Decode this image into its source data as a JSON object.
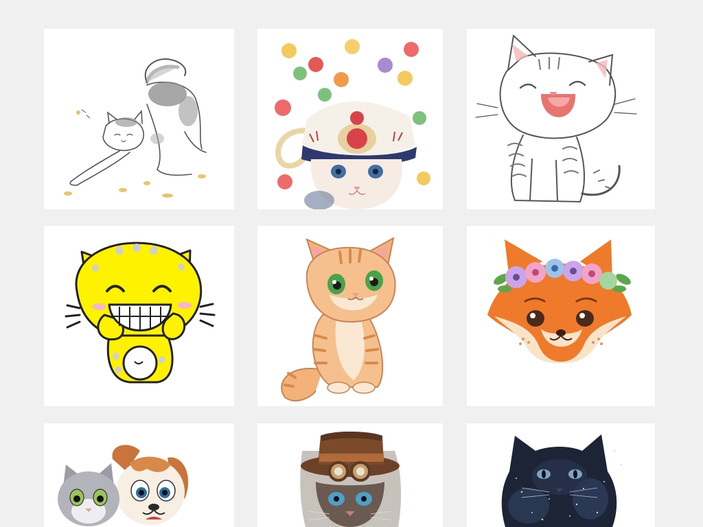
{
  "background_color": "#f0f0f0",
  "tile_color": "#ffffff",
  "tiles": [
    {
      "name": "tile-stretching-cat",
      "depicts": "sketch-cat-stretching"
    },
    {
      "name": "tile-teacup-cat",
      "depicts": "watercolor-kitten-in-teacup"
    },
    {
      "name": "tile-yawning-cat",
      "depicts": "sketch-tabby-kitten-yawning"
    },
    {
      "name": "tile-yellow-cat",
      "depicts": "yellow-cartoon-cat-grinning"
    },
    {
      "name": "tile-orange-kitten",
      "depicts": "orange-striped-cartoon-kitten"
    },
    {
      "name": "tile-fox-flower-crown",
      "depicts": "fox-face-with-flower-crown"
    },
    {
      "name": "tile-cat-and-puppy",
      "depicts": "cartoon-cat-and-puppy"
    },
    {
      "name": "tile-steampunk-cat",
      "depicts": "steampunk-cat-with-top-hat"
    },
    {
      "name": "tile-galaxy-black-cat",
      "depicts": "black-cat-starry-texture"
    }
  ]
}
